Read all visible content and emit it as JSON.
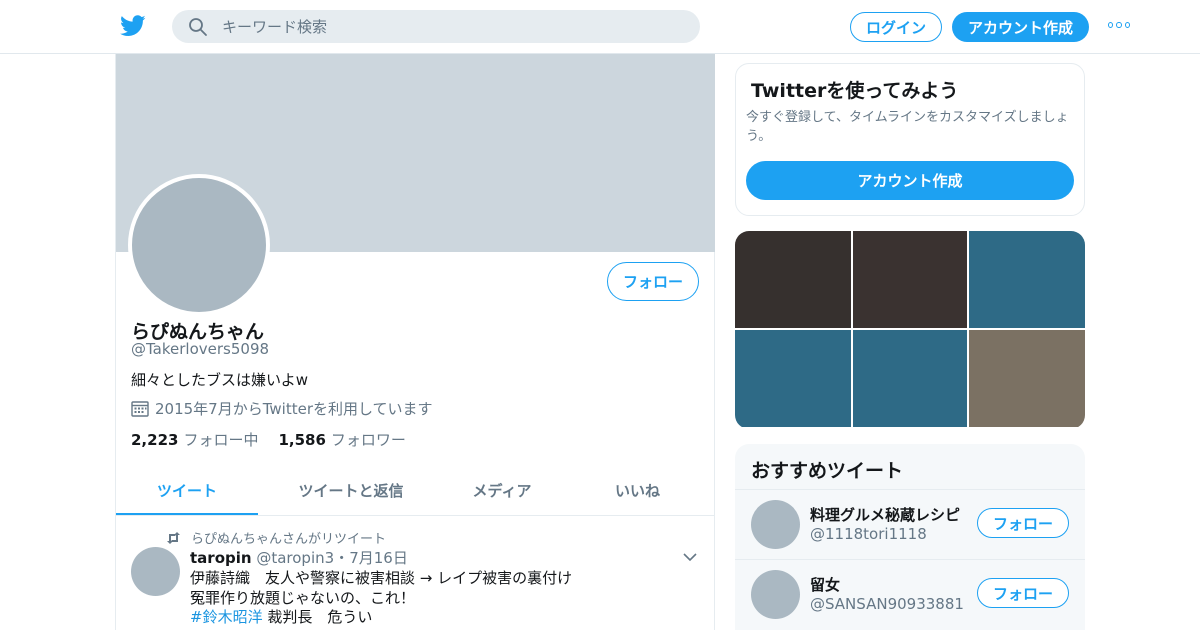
{
  "header": {
    "search_placeholder": "キーワード検索",
    "login_label": "ログイン",
    "signup_label": "アカウント作成",
    "logo_icon": "twitter-bird-icon",
    "more_icon": "more-dots-icon",
    "accent_color": "#1da1f2"
  },
  "profile": {
    "display_name": "らぴぬんちゃん",
    "handle": "@Takerlovers5098",
    "bio": "細々としたブスは嫌いよw",
    "joined": "2015年7月からTwitterを利用しています",
    "following_count": "2,223",
    "following_label": "フォロー中",
    "followers_count": "1,586",
    "followers_label": "フォロワー",
    "follow_label": "フォロー"
  },
  "tabs": [
    {
      "label": "ツイート",
      "active": true
    },
    {
      "label": "ツイートと返信",
      "active": false
    },
    {
      "label": "メディア",
      "active": false
    },
    {
      "label": "いいね",
      "active": false
    }
  ],
  "tweet": {
    "retweet_note": "らぴぬんちゃんさんがリツイート",
    "user_name": "taropin",
    "user_handle": "@taropin3",
    "date": "7月16日",
    "line1": "伊藤詩織　友人や警察に被害相談 → レイプ被害の裏付け",
    "line2": "冤罪作り放題じゃないの、これ！",
    "hashtag": "#鈴木昭洋",
    "line3_rest": " 裁判長　危うい"
  },
  "signup_card": {
    "title": "Twitterを使ってみよう",
    "description": "今すぐ登録して、タイムラインをカスタマイズしましょう。",
    "button_label": "アカウント作成"
  },
  "media_grid": {
    "colors": [
      "#36302e",
      "#3a3230",
      "#2e6a86",
      "#2e6a86",
      "#2e6a86",
      "#7b7163"
    ]
  },
  "recommended": {
    "title": "おすすめツイート",
    "items": [
      {
        "name": "料理グルメ秘蔵レシピ",
        "handle": "@1118tori1118",
        "follow_label": "フォロー"
      },
      {
        "name": "留女",
        "handle": "@SANSAN90933881",
        "follow_label": "フォロー"
      }
    ]
  }
}
